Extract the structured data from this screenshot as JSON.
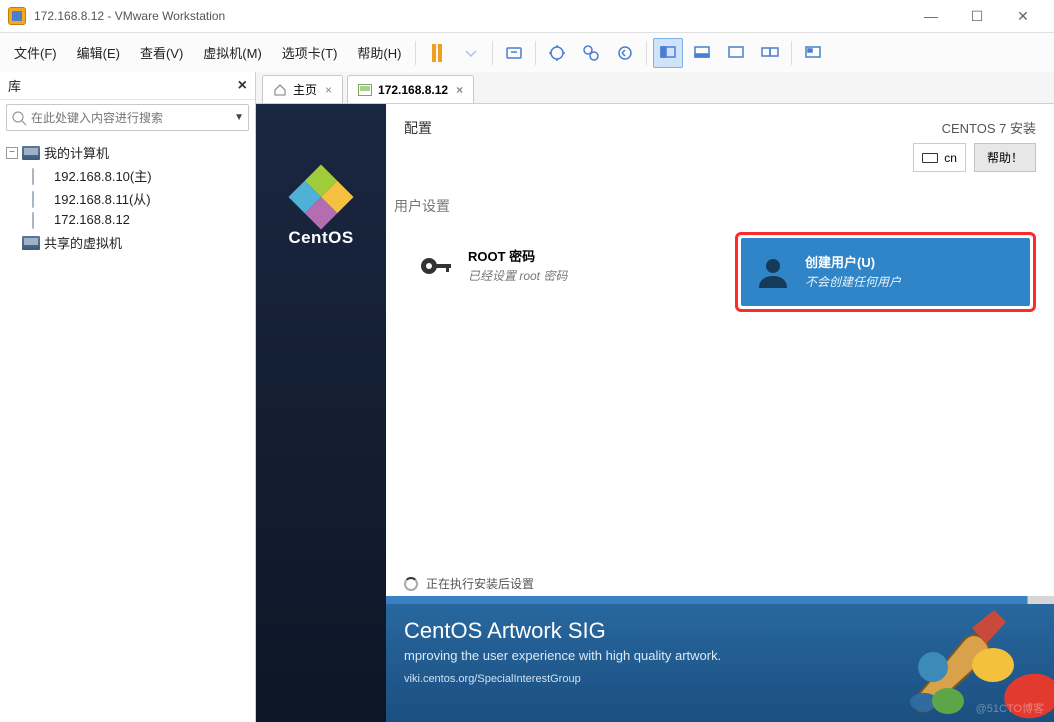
{
  "window": {
    "title": "172.168.8.12 - VMware Workstation"
  },
  "menu": {
    "file": "文件(F)",
    "edit": "编辑(E)",
    "view": "查看(V)",
    "vm": "虚拟机(M)",
    "tabs": "选项卡(T)",
    "help": "帮助(H)"
  },
  "sidebar": {
    "lib_label": "库",
    "search_placeholder": "在此处键入内容进行搜索",
    "my_computer": "我的计算机",
    "shared_vms": "共享的虚拟机",
    "vms": [
      {
        "label": "192.168.8.10(主)"
      },
      {
        "label": "192.168.8.11(从)"
      },
      {
        "label": "172.168.8.12"
      }
    ]
  },
  "tabs": {
    "home": "主页",
    "active": "172.168.8.12"
  },
  "centos": {
    "brand": "CentOS",
    "header_left": "配置",
    "header_right": "CENTOS 7 安装",
    "lang_code": "cn",
    "help": "帮助！",
    "section_user": "用户设置",
    "root": {
      "title": "ROOT 密码",
      "subtitle": "已经设置 root 密码"
    },
    "create_user": {
      "title": "创建用户(U)",
      "subtitle": "不会创建任何用户"
    },
    "progress_text": "正在执行安装后设置",
    "banner": {
      "title": "CentOS Artwork SIG",
      "subtitle": "mproving the user experience with high quality artwork.",
      "link": "viki.centos.org/SpecialInterestGroup"
    }
  },
  "watermark": "@51CTO博客"
}
